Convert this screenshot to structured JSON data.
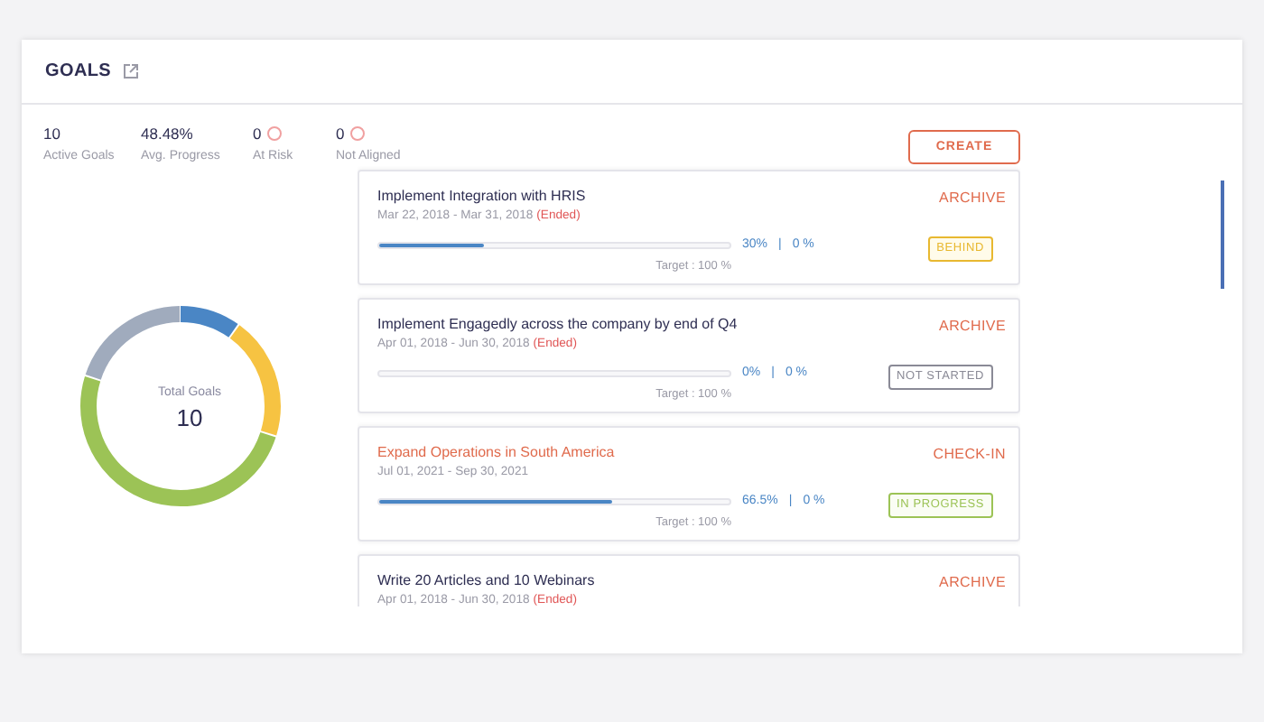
{
  "header": {
    "title": "GOALS"
  },
  "stats": [
    {
      "value": "10",
      "label": "Active Goals",
      "info": false
    },
    {
      "value": "48.48%",
      "label": "Avg. Progress",
      "info": false
    },
    {
      "value": "0",
      "label": "At Risk",
      "info": true
    },
    {
      "value": "0",
      "label": "Not Aligned",
      "info": true
    }
  ],
  "create_button": "CREATE",
  "total_chart": {
    "label": "Total Goals",
    "value": "10"
  },
  "goals": [
    {
      "title": "Implement Integration with HRIS",
      "highlighted": false,
      "dates": "Mar 22, 2018 - Mar 31, 2018",
      "ended": "(Ended)",
      "level": 0.3,
      "reading": "30%",
      "separator": "|",
      "reading_2": "0 %",
      "target": "Target : 100 %",
      "action": "ARCHIVE",
      "status": {
        "kind": "behind",
        "label": "BEHIND"
      }
    },
    {
      "title": "Implement Engagedly across the company by end of Q4",
      "highlighted": false,
      "dates": "Apr 01, 2018 - Jun 30, 2018",
      "ended": "(Ended)",
      "level": 0,
      "reading": "0%",
      "separator": "|",
      "reading_2": "0 %",
      "target": "Target : 100 %",
      "action": "ARCHIVE",
      "status": {
        "kind": "not_started",
        "label": "NOT STARTED"
      }
    },
    {
      "title": "Expand Operations in South America",
      "highlighted": true,
      "dates": "Jul 01, 2021 - Sep 30, 2021",
      "level": 0.665,
      "reading": "66.5%",
      "separator": "|",
      "reading_2": "0 %",
      "target": "Target : 100 %",
      "action": "CHECK-IN",
      "status": {
        "kind": "in_progress",
        "label": "IN PROGRESS"
      }
    },
    {
      "title": "Write 20 Articles and 10 Webinars",
      "highlighted": false,
      "dates": "Apr 01, 2018 - Jun 30, 2018",
      "ended": "(Ended)",
      "action": "ARCHIVE"
    }
  ]
}
